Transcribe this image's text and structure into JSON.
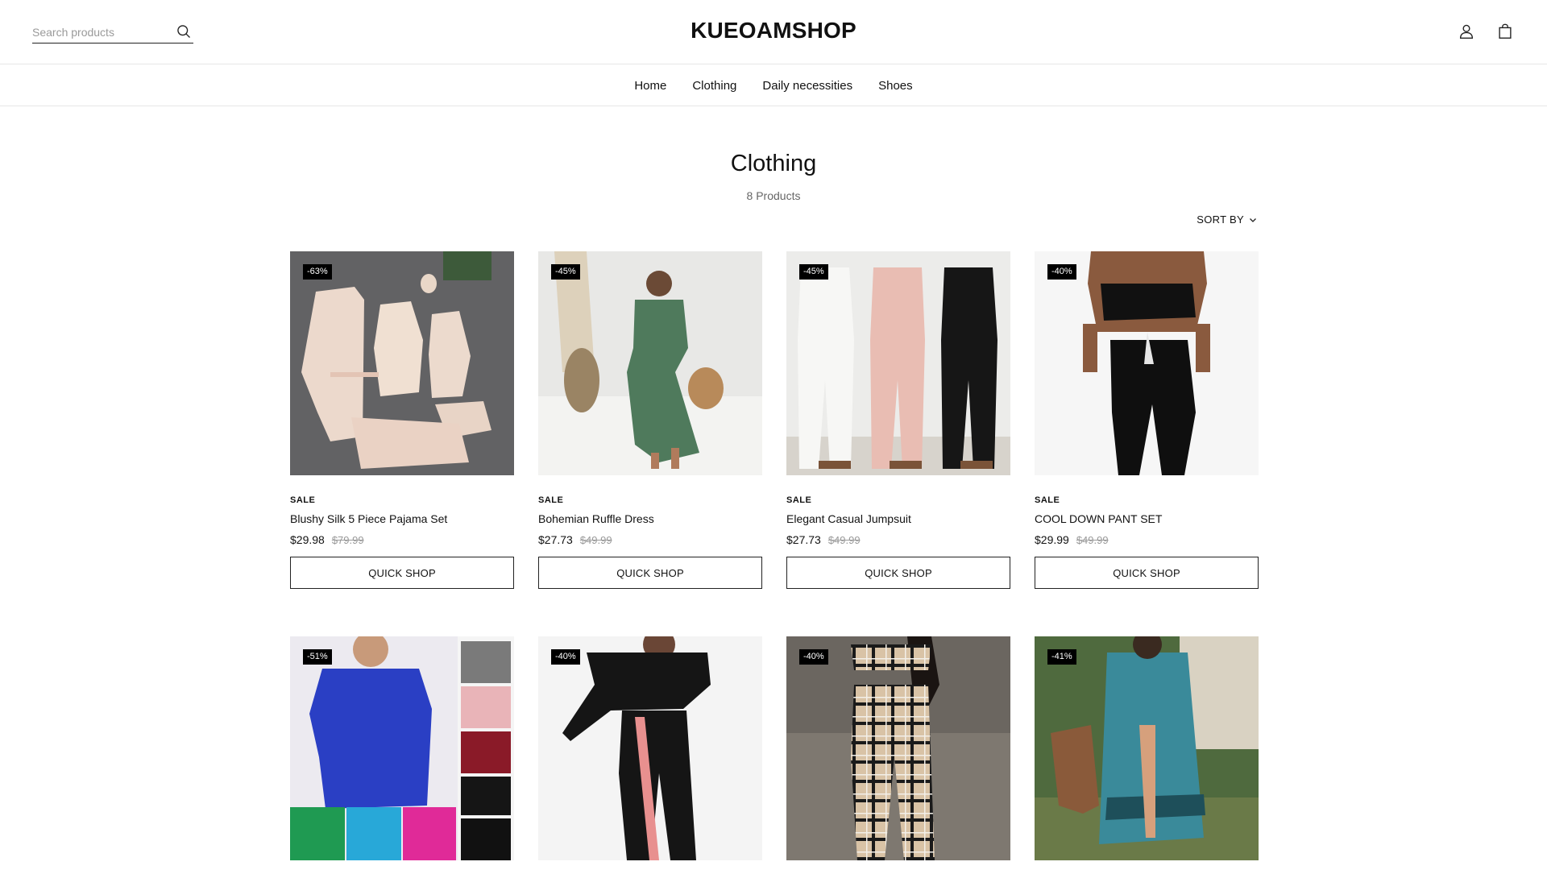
{
  "header": {
    "search_placeholder": "Search products",
    "logo": "KUEOAMSHOP",
    "icons": {
      "search": "search-icon",
      "account": "user-icon",
      "cart": "shopping-bag-icon"
    }
  },
  "nav": [
    "Home",
    "Clothing",
    "Daily necessities",
    "Shoes"
  ],
  "collection": {
    "title": "Clothing",
    "count": "8 Products",
    "sort_label": "SORT BY"
  },
  "products": [
    {
      "badge": "-63%",
      "sale": "SALE",
      "title": "Blushy Silk 5 Piece Pajama Set",
      "price": "$29.98",
      "compare": "$79.99",
      "button": "QUICK SHOP"
    },
    {
      "badge": "-45%",
      "sale": "SALE",
      "title": "Bohemian Ruffle Dress",
      "price": "$27.73",
      "compare": "$49.99",
      "button": "QUICK SHOP"
    },
    {
      "badge": "-45%",
      "sale": "SALE",
      "title": "Elegant Casual Jumpsuit",
      "price": "$27.73",
      "compare": "$49.99",
      "button": "QUICK SHOP"
    },
    {
      "badge": "-40%",
      "sale": "SALE",
      "title": "COOL DOWN PANT SET",
      "price": "$29.99",
      "compare": "$49.99",
      "button": "QUICK SHOP"
    },
    {
      "badge": "-51%"
    },
    {
      "badge": "-40%"
    },
    {
      "badge": "-40%"
    },
    {
      "badge": "-41%"
    }
  ],
  "colors": {
    "text": "#111111",
    "muted": "#999999",
    "badge_bg": "#000000",
    "border": "#e6e6e6"
  }
}
